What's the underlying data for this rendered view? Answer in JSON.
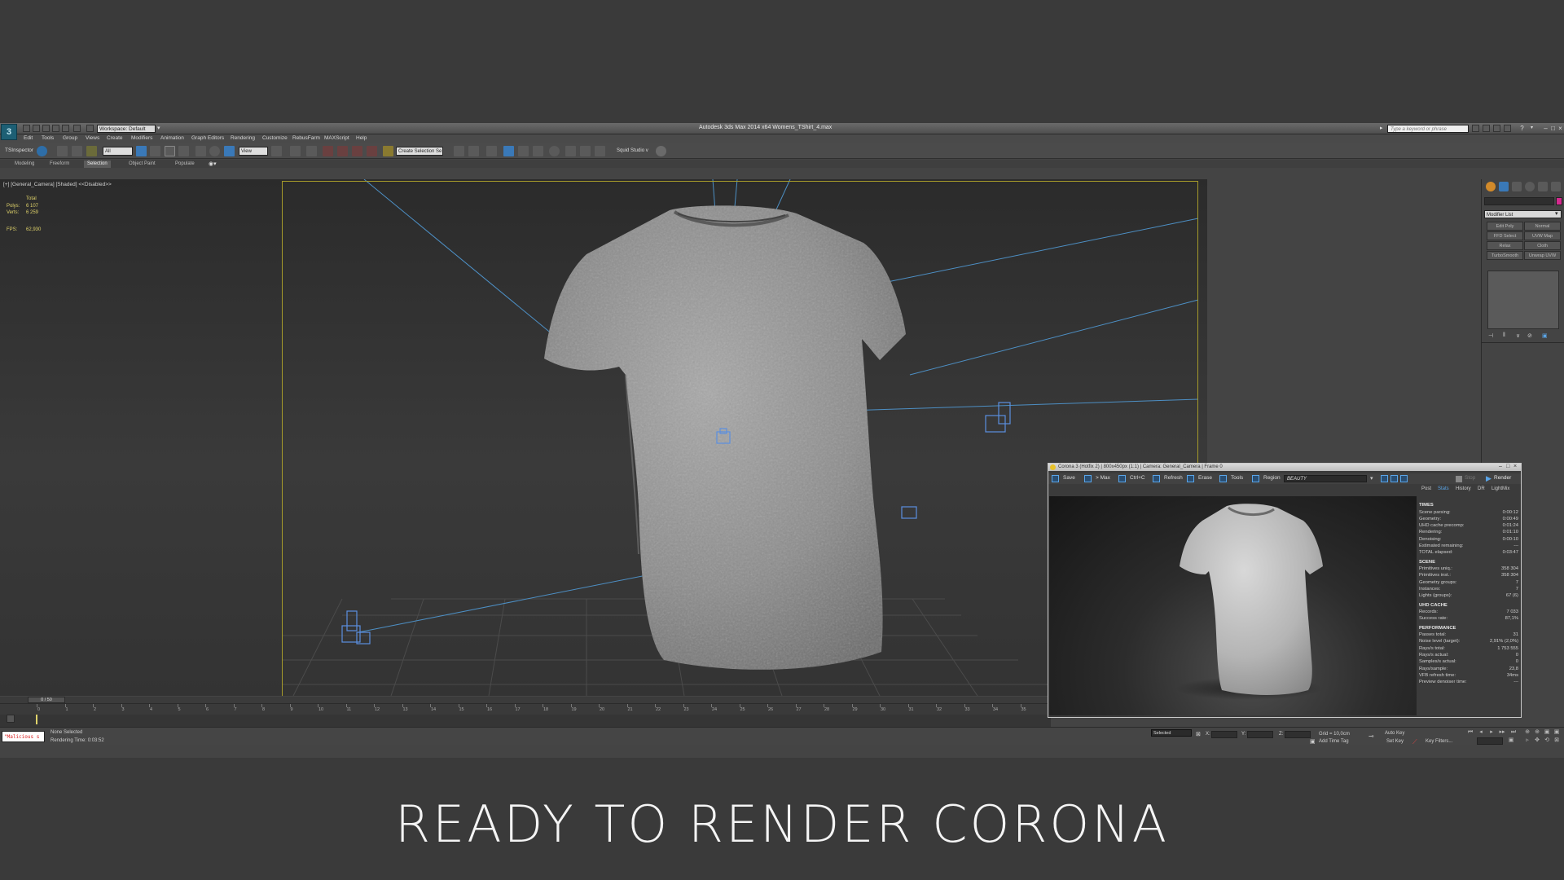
{
  "app": {
    "title": "Autodesk 3ds Max 2014 x64    Womens_TShirt_4.max",
    "logo": "3ds Max logo",
    "workspace": "Workspace: Default",
    "search_placeholder": "Type a keyword or phrase"
  },
  "menu": [
    "Edit",
    "Tools",
    "Group",
    "Views",
    "Create",
    "Modifiers",
    "Animation",
    "Graph Editors",
    "Rendering",
    "Customize",
    "RebusFarm",
    "MAXScript",
    "Help"
  ],
  "toolbar": {
    "tsinspector": "TSInspector",
    "filter": "All",
    "ref_coord": "View",
    "named_selection": "Create Selection Se",
    "squid_studio": "Squid Studio v"
  },
  "ribbon_tabs": [
    {
      "label": "Modeling",
      "active": false
    },
    {
      "label": "Freeform",
      "active": false
    },
    {
      "label": "Selection",
      "active": true
    },
    {
      "label": "Object Paint",
      "active": false
    },
    {
      "label": "Populate",
      "active": false
    }
  ],
  "viewport": {
    "label": "[+] [General_Camera] [Shaded] <<Disabled>>",
    "stats": {
      "header": "Total",
      "polys_label": "Polys:",
      "polys": "6 107",
      "verts_label": "Verts:",
      "verts": "6 259",
      "fps_label": "FPS:",
      "fps": "62,930"
    }
  },
  "command_panel": {
    "modifier_list": "Modifier List",
    "buttons": [
      "Edit Poly",
      "Normal",
      "FFD Select",
      "UVW Map",
      "Relax",
      "Cloth",
      "TurboSmooth",
      "Unwrap UVW"
    ]
  },
  "timeline": {
    "slider_label": "0 / 50",
    "ticks": [
      "0",
      "1",
      "2",
      "3",
      "4",
      "5",
      "6",
      "7",
      "8",
      "9",
      "10",
      "11",
      "12",
      "13",
      "14",
      "15",
      "16",
      "17",
      "18",
      "19",
      "20",
      "21",
      "22",
      "23",
      "24",
      "25",
      "26",
      "27",
      "28",
      "29",
      "30",
      "31",
      "32",
      "33",
      "34",
      "35"
    ]
  },
  "status": {
    "maxscript": "\"Malicious s",
    "selection": "None Selected",
    "render_time": "Rendering Time: 0:03:52",
    "x_label": "X:",
    "y_label": "Y:",
    "z_label": "Z:",
    "grid": "Grid = 10,0cm",
    "add_time_tag": "Add Time Tag",
    "auto_key": "Auto Key",
    "set_key": "Set Key",
    "selected": "Selected",
    "key_filters": "Key Filters..."
  },
  "vfb": {
    "title": "Corona 3 (Hotfix 2) | 800x450px (1:1) | Camera: General_Camera | Frame 0",
    "buttons": [
      "Save",
      "> Max",
      "Ctrl+C",
      "Refresh",
      "Erase",
      "Tools",
      "Region"
    ],
    "pass": "BEAUTY",
    "stop": "Stop",
    "render": "Render",
    "tabs": [
      {
        "label": "Post",
        "active": false
      },
      {
        "label": "Stats",
        "active": true
      },
      {
        "label": "History",
        "active": false
      },
      {
        "label": "DR",
        "active": false
      },
      {
        "label": "LightMix",
        "active": false
      }
    ],
    "stats": [
      {
        "header": "TIMES",
        "rows": [
          [
            "Scene parsing:",
            "0:00:12"
          ],
          [
            "Geometry:",
            "0:00:49"
          ],
          [
            "UHD cache precomp:",
            "0:01:24"
          ],
          [
            "Rendering:",
            "0:01:10"
          ],
          [
            "Denoising:",
            "0:00:10"
          ],
          [
            "Estimated remaining:",
            "---"
          ],
          [
            "TOTAL elapsed:",
            "0:03:47"
          ]
        ]
      },
      {
        "header": "SCENE",
        "rows": [
          [
            "Primitives uniq.:",
            "358 304"
          ],
          [
            "Primitives inst.:",
            "358 304"
          ],
          [
            "Geometry groups:",
            "7"
          ],
          [
            "Instances:",
            "7"
          ],
          [
            "Lights (groups):",
            "67 (6)"
          ]
        ]
      },
      {
        "header": "UHD CACHE",
        "rows": [
          [
            "Records:",
            "7 033"
          ],
          [
            "Success rate:",
            "87,1%"
          ]
        ]
      },
      {
        "header": "PERFORMANCE",
        "rows": [
          [
            "Passes total:",
            "31"
          ],
          [
            "Noise level (target):",
            "2,91% (2,0%)"
          ],
          [
            "Rays/s total:",
            "1 753 555"
          ],
          [
            "Rays/s actual:",
            "0"
          ],
          [
            "Samples/s actual:",
            "0"
          ],
          [
            "Rays/sample:",
            "23,8"
          ],
          [
            "VFB refresh time:",
            "34ms"
          ],
          [
            "Preview denoiser time:",
            "---"
          ]
        ]
      }
    ]
  },
  "caption": "READY TO RENDER  CORONA",
  "colors": {
    "background": "#3a3a3a",
    "viewport": "#313131",
    "safe_frame": "#a59a2a",
    "light_lines": "#4d8fc4",
    "stats_yellow": "#e0d36a",
    "corona_accent": "#5aa5e8"
  }
}
